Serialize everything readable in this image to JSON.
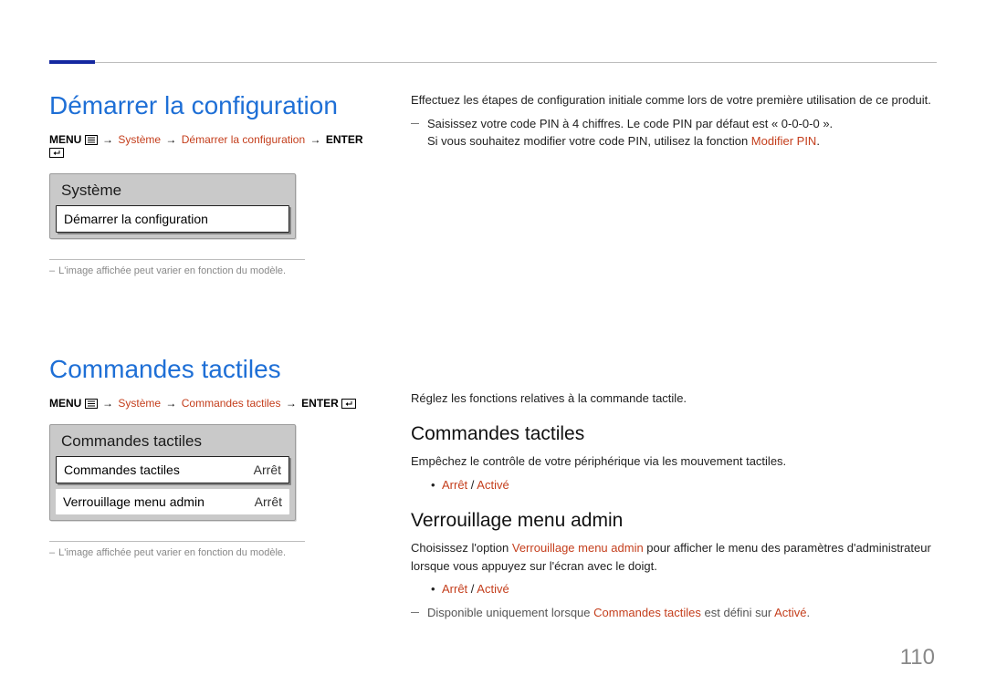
{
  "page_number": "110",
  "section1": {
    "title": "Démarrer la configuration",
    "breadcrumb": {
      "menu": "MENU",
      "path1": "Système",
      "path2": "Démarrer la configuration",
      "enter": "ENTER"
    },
    "menu": {
      "title": "Système",
      "item_label": "Démarrer la configuration"
    },
    "image_note": "L'image affichée peut varier en fonction du modèle.",
    "body1": "Effectuez les étapes de configuration initiale comme lors de votre première utilisation de ce produit.",
    "dash1_a": "Saisissez votre code PIN à 4 chiffres. Le code PIN par défaut est « 0-0-0-0 ».",
    "dash1_b1": "Si vous souhaitez modifier votre code PIN, utilisez la fonction ",
    "dash1_b_red": "Modifier PIN",
    "dash1_b2": "."
  },
  "section2": {
    "title": "Commandes tactiles",
    "breadcrumb": {
      "menu": "MENU",
      "path1": "Système",
      "path2": "Commandes tactiles",
      "enter": "ENTER"
    },
    "menu": {
      "title": "Commandes tactiles",
      "row1_label": "Commandes tactiles",
      "row1_value": "Arrêt",
      "row2_label": "Verrouillage menu admin",
      "row2_value": "Arrêt"
    },
    "image_note": "L'image affichée peut varier en fonction du modèle.",
    "body_intro": "Réglez les fonctions relatives à la commande tactile.",
    "sub1_title": "Commandes tactiles",
    "sub1_body": "Empêchez le contrôle de votre périphérique via les mouvement tactiles.",
    "opt_off": "Arrêt",
    "opt_on": "Activé",
    "sub2_title": "Verrouillage menu admin",
    "sub2_body_a": "Choisissez l'option ",
    "sub2_body_red": "Verrouillage menu admin",
    "sub2_body_b": " pour afficher le menu des paramètres d'administrateur lorsque vous appuyez sur l'écran avec le doigt.",
    "dash2_a": "Disponible uniquement lorsque ",
    "dash2_red1": "Commandes tactiles",
    "dash2_b": " est défini sur ",
    "dash2_red2": "Activé",
    "dash2_c": "."
  }
}
